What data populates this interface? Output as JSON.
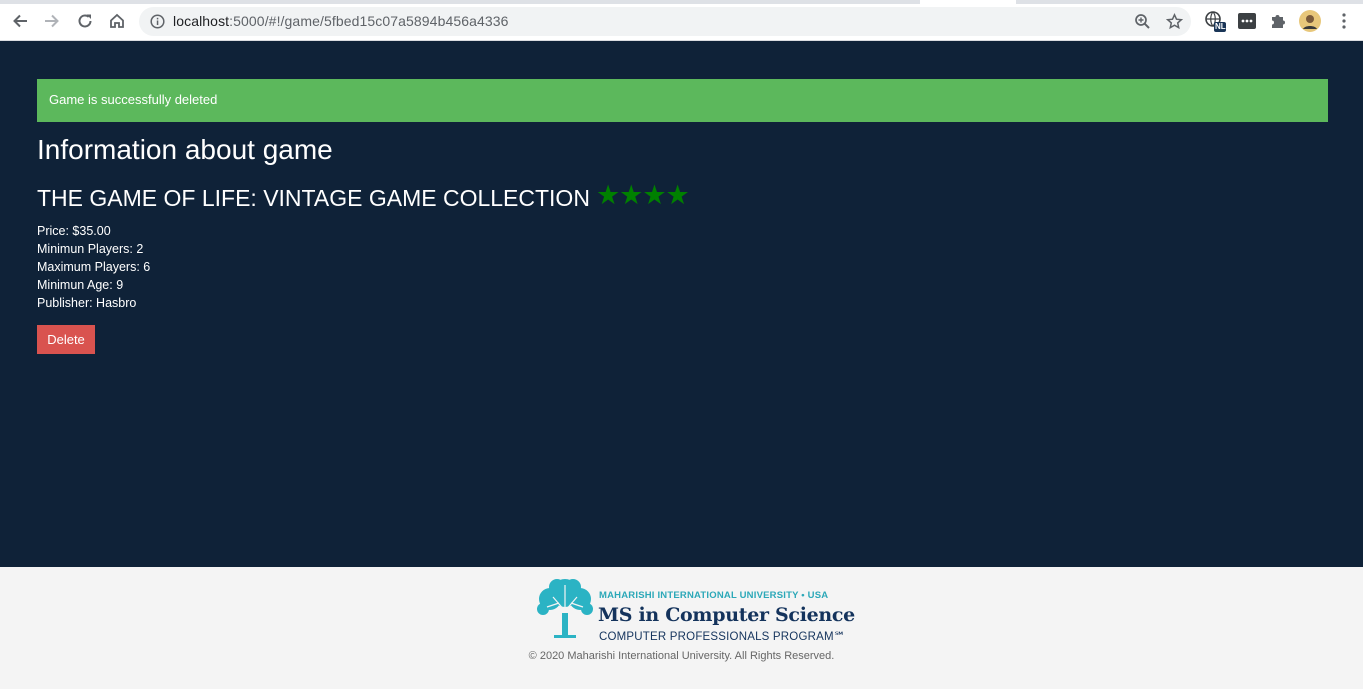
{
  "browser": {
    "url_host": "localhost",
    "url_path": ":5000/#!/game/5fbed15c07a5894b456a4336",
    "profile_badge": "NL"
  },
  "alert": {
    "message": "Game is successfully deleted",
    "color": "#5cb85c"
  },
  "page": {
    "heading": "Information about game",
    "background": "#0f2238"
  },
  "game": {
    "title": "THE GAME OF LIFE: VINTAGE GAME COLLECTION",
    "rating": 4,
    "stars": "★★★★",
    "star_color": "#008000",
    "price": "Price: $35.00",
    "min_players": "Minimun Players: 2",
    "max_players": "Maximum Players: 6",
    "min_age": "Minimun Age: 9",
    "publisher": "Publisher: Hasbro"
  },
  "actions": {
    "delete_label": "Delete",
    "delete_color": "#d9534f"
  },
  "footer": {
    "logo_line1": "MAHARISHI INTERNATIONAL UNIVERSITY • USA",
    "logo_line2": "MS in Computer Science",
    "logo_line3": "COMPUTER PROFESSIONALS PROGRAM℠",
    "copyright": "© 2020 Maharishi International University. All Rights Reserved."
  },
  "icons": [
    "back-icon",
    "forward-icon",
    "reload-icon",
    "home-icon",
    "info-icon",
    "zoom-icon",
    "bookmark-star-icon",
    "translate-extension-icon",
    "extension-icon",
    "puzzle-icon",
    "profile-avatar",
    "menu-icon",
    "tree-logo-icon"
  ]
}
